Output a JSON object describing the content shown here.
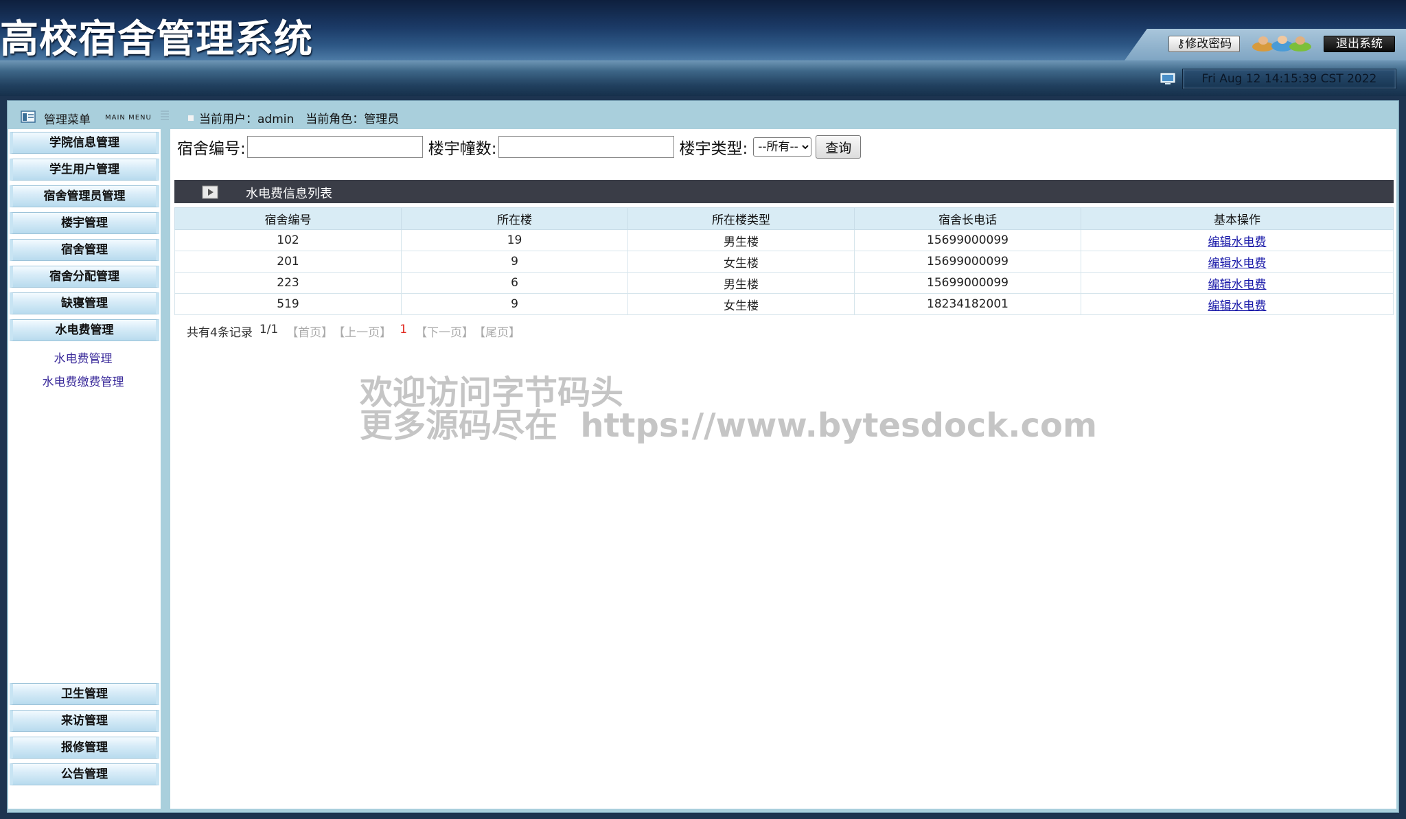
{
  "app": {
    "title": "高校宿舍管理系统"
  },
  "header": {
    "change_password": "修改密码",
    "logout": "退出系统",
    "datetime": "Fri Aug 12 14:15:39 CST 2022"
  },
  "sidebar": {
    "title": "管理菜单",
    "subtitle": "MAIN MENU",
    "top_items": [
      {
        "label": "学院信息管理"
      },
      {
        "label": "学生用户管理"
      },
      {
        "label": "宿舍管理员管理"
      },
      {
        "label": "楼宇管理"
      },
      {
        "label": "宿舍管理"
      },
      {
        "label": "宿舍分配管理"
      },
      {
        "label": "缺寝管理"
      },
      {
        "label": "水电费管理"
      }
    ],
    "sub_items": [
      {
        "label": "水电费管理"
      },
      {
        "label": "水电费缴费管理"
      }
    ],
    "bottom_items": [
      {
        "label": "卫生管理"
      },
      {
        "label": "来访管理"
      },
      {
        "label": "报修管理"
      },
      {
        "label": "公告管理"
      }
    ]
  },
  "content": {
    "user_info": "当前用户：admin　当前角色：管理员",
    "search": {
      "dorm_label": "宿舍编号:",
      "dorm_value": "",
      "building_label": "楼宇幢数:",
      "building_value": "",
      "type_label": "楼宇类型:",
      "type_selected": "--所有--",
      "query_label": "查询"
    },
    "list_title": "水电费信息列表",
    "table": {
      "headers": [
        "宿舍编号",
        "所在楼",
        "所在楼类型",
        "宿舍长电话",
        "基本操作"
      ],
      "rows": [
        {
          "dorm": "102",
          "building": "19",
          "type": "男生楼",
          "phone": "15699000099",
          "action": "编辑水电费"
        },
        {
          "dorm": "201",
          "building": "9",
          "type": "女生楼",
          "phone": "15699000099",
          "action": "编辑水电费"
        },
        {
          "dorm": "223",
          "building": "6",
          "type": "男生楼",
          "phone": "15699000099",
          "action": "编辑水电费"
        },
        {
          "dorm": "519",
          "building": "9",
          "type": "女生楼",
          "phone": "18234182001",
          "action": "编辑水电费"
        }
      ]
    },
    "pager": {
      "total": "共有4条记录",
      "page": "1/1",
      "first": "【首页】",
      "prev": "【上一页】",
      "current": "1",
      "next": "【下一页】",
      "last": "【尾页】"
    }
  },
  "watermark": {
    "line1": "欢迎访问字节码头",
    "line2": "更多源码尽在  https://www.bytesdock.com"
  }
}
